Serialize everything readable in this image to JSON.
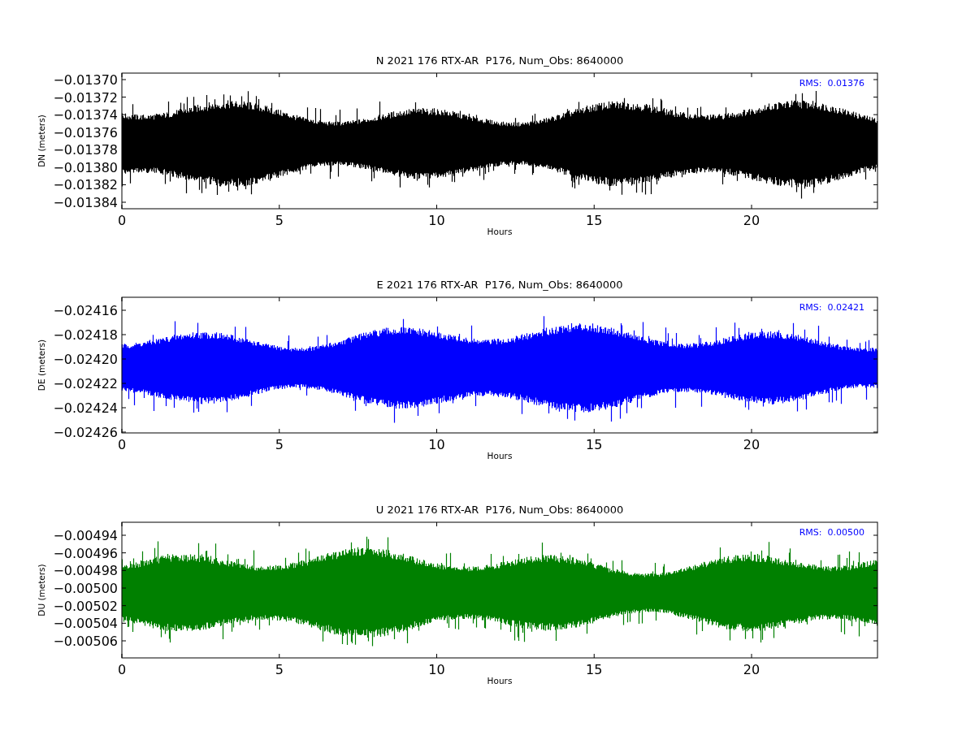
{
  "panels": [
    {
      "title": "N 2021 176 RTX-AR  P176, Num_Obs: 8640000",
      "ylabel": "DN (meters)",
      "xlabel": "Hours",
      "rms": "RMS:  0.01376",
      "color": "#000000",
      "yticks": [
        "−0.01370",
        "−0.01372",
        "−0.01374",
        "−0.01376",
        "−0.01378",
        "−0.01380",
        "−0.01382",
        "−0.01384"
      ],
      "xticks": [
        "0",
        "5",
        "10",
        "15",
        "20"
      ]
    },
    {
      "title": "E 2021 176 RTX-AR  P176, Num_Obs: 8640000",
      "ylabel": "DE (meters)",
      "xlabel": "Hours",
      "rms": "RMS:  0.02421",
      "color": "#0000ff",
      "yticks": [
        "−0.02416",
        "−0.02418",
        "−0.02420",
        "−0.02422",
        "−0.02424",
        "−0.02426"
      ],
      "xticks": [
        "0",
        "5",
        "10",
        "15",
        "20"
      ]
    },
    {
      "title": "U 2021 176 RTX-AR  P176, Num_Obs: 8640000",
      "ylabel": "DU (meters)",
      "xlabel": "Hours",
      "rms": "RMS:  0.00500",
      "color": "#008000",
      "yticks": [
        "−0.00494",
        "−0.00496",
        "−0.00498",
        "−0.00500",
        "−0.00502",
        "−0.00504",
        "−0.00506"
      ],
      "xticks": [
        "0",
        "5",
        "10",
        "15",
        "20"
      ]
    }
  ]
}
